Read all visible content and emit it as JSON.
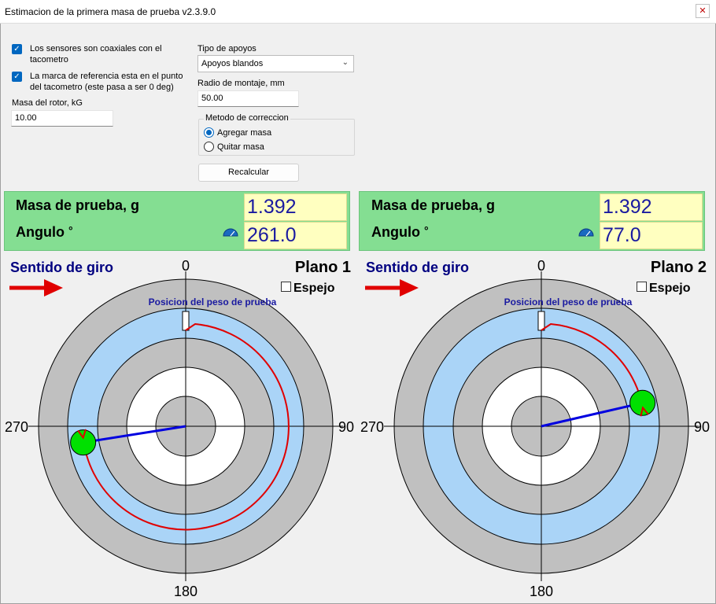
{
  "window": {
    "title": "Estimacion de la primera masa de prueba v2.3.9.0",
    "close_glyph": "✕"
  },
  "settings": {
    "coaxial_sensors": {
      "label_line1": "Los sensores son coaxiales con el",
      "label_line2": "tacometro",
      "checked": true
    },
    "reference_mark": {
      "label_line1": "La marca de referencia esta en el punto",
      "label_line2": "del tacometro (este pasa a ser 0 deg)",
      "checked": true
    },
    "rotor_mass": {
      "label": "Masa del rotor, kG",
      "value": "10.00"
    },
    "support_type": {
      "label": "Tipo de apoyos",
      "selected": "Apoyos blandos"
    },
    "mount_radius": {
      "label": "Radio de montaje, mm",
      "value": "50.00"
    },
    "correction_method": {
      "label": "Metodo de correccion",
      "options": [
        "Agregar masa",
        "Quitar masa"
      ],
      "selected": "Agregar masa"
    },
    "recalc_label": "Recalcular"
  },
  "planes": [
    {
      "mass_label": "Masa de prueba, g",
      "angle_label": "Angulo",
      "degree_mark": "°",
      "mass_value": "1.392",
      "angle_value": "261.0",
      "angle_deg": 261.0,
      "rotation_label": "Sentido de giro",
      "plane_title": "Plano 1",
      "mirror_label": "Espejo",
      "mirror_checked": false,
      "position_label": "Posicion del peso de prueba",
      "axis_labels": {
        "top": "0",
        "right": "90",
        "bottom": "180",
        "left": "270"
      }
    },
    {
      "mass_label": "Masa de prueba, g",
      "angle_label": "Angulo",
      "degree_mark": "°",
      "mass_value": "1.392",
      "angle_value": "77.0",
      "angle_deg": 77.0,
      "rotation_label": "Sentido de giro",
      "plane_title": "Plano 2",
      "mirror_label": "Espejo",
      "mirror_checked": false,
      "position_label": "Posicion del peso de prueba",
      "axis_labels": {
        "top": "0",
        "right": "90",
        "bottom": "180",
        "left": "270"
      }
    }
  ],
  "colors": {
    "panel_green": "#84de92",
    "value_yellow": "#ffffc0",
    "value_text": "#1a1aa0",
    "ring_gray": "#c0c0c0",
    "ring_blue": "#aad4f7",
    "weight_green": "#00e000",
    "vector_blue": "#0000e0",
    "arc_red": "#e00000",
    "title_navy": "#000080"
  }
}
